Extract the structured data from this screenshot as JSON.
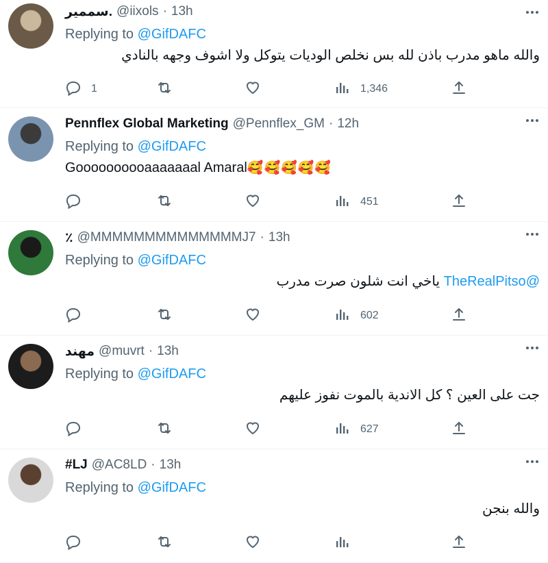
{
  "tweets": [
    {
      "name": "سممير.",
      "handle": "@iixols",
      "time": "13h",
      "replying_prefix": "Replying to ",
      "replying_to": "@GifDAFC",
      "text_mention": "",
      "text": "والله ماهو مدرب باذن لله بس نخلص الوديات يتوكل ولا اشوف وجهه بالنادي",
      "rtl": true,
      "replies": "1",
      "retweets": "",
      "likes": "",
      "views": "1,346",
      "avatar_colors": [
        "#6b5a48",
        "#c9b89c"
      ]
    },
    {
      "name": "Pennflex Global Marketing",
      "handle": "@Pennflex_GM",
      "time": "12h",
      "replying_prefix": "Replying to ",
      "replying_to": "@GifDAFC",
      "text_mention": "",
      "text": "Goooooooooaaaaaaal Amaral",
      "emoji": "🥰🥰🥰🥰🥰",
      "rtl": false,
      "replies": "",
      "retweets": "",
      "likes": "",
      "views": "451",
      "avatar_colors": [
        "#7a94b0",
        "#3b3b3b"
      ]
    },
    {
      "name": "٪",
      "handle": "@MMMMMMMMMMMMMMJ7",
      "time": "13h",
      "replying_prefix": "Replying to ",
      "replying_to": "@GifDAFC",
      "text_mention": "@TheRealPitso",
      "text": " ياخي انت شلون صرت مدرب",
      "rtl": true,
      "replies": "",
      "retweets": "",
      "likes": "",
      "views": "602",
      "avatar_colors": [
        "#2f7a3a",
        "#1a1a1a"
      ]
    },
    {
      "name": "مهند",
      "handle": "@muvrt",
      "time": "13h",
      "replying_prefix": "Replying to ",
      "replying_to": "@GifDAFC",
      "text_mention": "",
      "text": "جت على العين ؟ كل الاندية بالموت نفوز عليهم",
      "rtl": true,
      "replies": "",
      "retweets": "",
      "likes": "",
      "views": "627",
      "avatar_colors": [
        "#1c1c1c",
        "#8a6a50"
      ]
    },
    {
      "name": "#LJ",
      "handle": "@AC8LD",
      "time": "13h",
      "replying_prefix": "Replying to ",
      "replying_to": "@GifDAFC",
      "text_mention": "",
      "text": "والله بنجن",
      "rtl": true,
      "replies": "",
      "retweets": "",
      "likes": "",
      "views": "",
      "avatar_colors": [
        "#d9d9d9",
        "#5a4030"
      ]
    }
  ],
  "colors": {
    "accent": "#1d9bf0",
    "muted": "#536471",
    "text": "#0f1419",
    "divider": "#eff3f4"
  },
  "icons": [
    "reply-icon",
    "retweet-icon",
    "like-icon",
    "views-icon",
    "share-icon",
    "more-icon"
  ]
}
